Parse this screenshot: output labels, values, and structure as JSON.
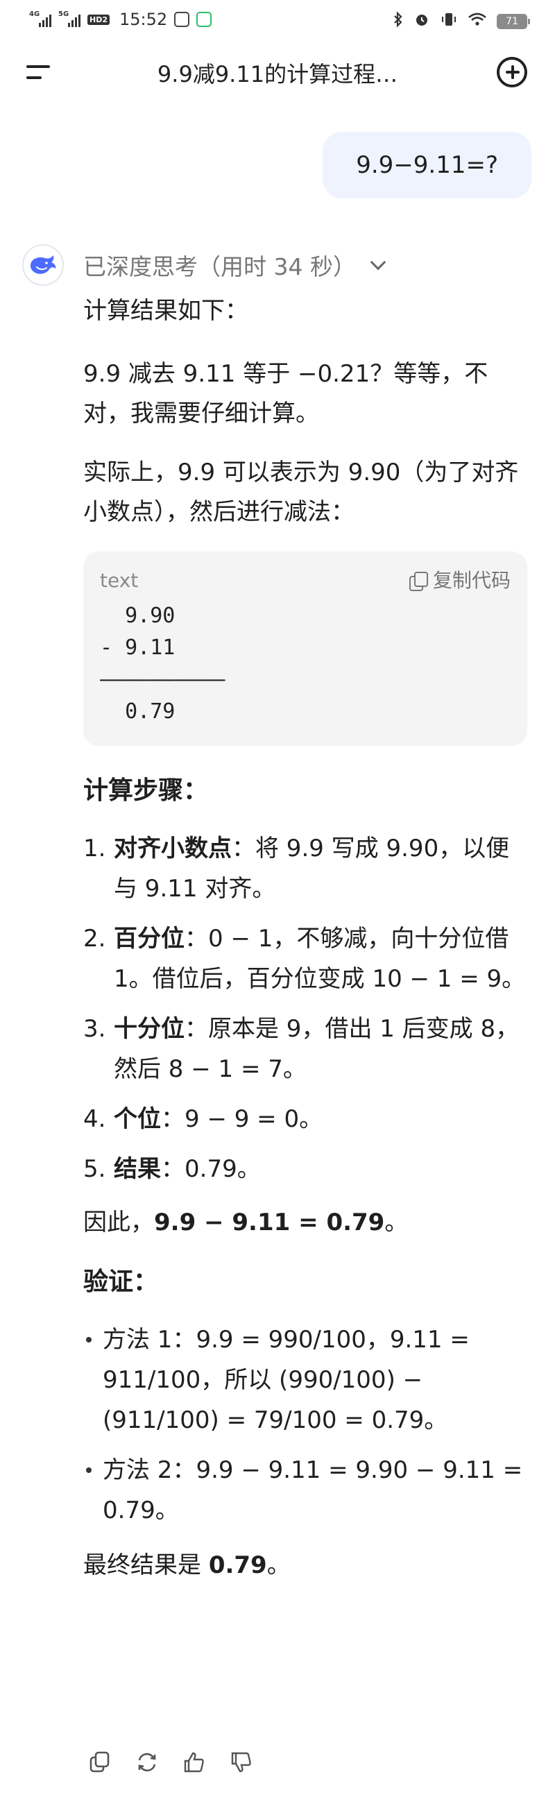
{
  "status_bar": {
    "time": "15:52",
    "network1": "4G",
    "network2": "5G",
    "hd_badge": "HD2",
    "battery": "71"
  },
  "header": {
    "title": "9.9减9.11的计算过程…"
  },
  "user_message": "9.9−9.11=?",
  "assistant": {
    "thinking_label": "已深度思考（用时 34 秒）",
    "intro": "计算结果如下：",
    "para1": "9.9 减去 9.11 等于 −0.21？等等，不对，我需要仔细计算。",
    "para2": "实际上，9.9 可以表示为 9.90（为了对齐小数点），然后进行减法：",
    "code": {
      "lang": "text",
      "copy_label": "复制代码",
      "body": "  9.90\n- 9.11\n——————————\n  0.79"
    },
    "steps_heading": "计算步骤：",
    "steps": [
      {
        "num": "1.",
        "bold": "对齐小数点",
        "text": "：将 9.9 写成 9.90，以便与 9.11 对齐。"
      },
      {
        "num": "2.",
        "bold": "百分位",
        "text": "：0 − 1，不够减，向十分位借 1。借位后，百分位变成 10 − 1 = 9。"
      },
      {
        "num": "3.",
        "bold": "十分位",
        "text": "：原本是 9，借出 1 后变成 8，然后 8 − 1 = 7。"
      },
      {
        "num": "4.",
        "bold": "个位",
        "text": "：9 − 9 = 0。"
      },
      {
        "num": "5.",
        "bold": "结果",
        "text": "：0.79。"
      }
    ],
    "conclusion_prefix": "因此，",
    "conclusion_bold": "9.9 − 9.11 = 0.79",
    "conclusion_suffix": "。",
    "verify_heading": "验证：",
    "verify": [
      "方法 1：9.9 = 990/100，9.11 = 911/100，所以 (990/100) − (911/100) = 79/100 = 0.79。",
      "方法 2：9.9 − 9.11 = 9.90 − 9.11 = 0.79。"
    ],
    "final_prefix": "最终结果是 ",
    "final_bold": "0.79",
    "final_suffix": "。"
  },
  "icons": {
    "menu": "menu-icon",
    "new_chat": "plus-circle-icon",
    "avatar": "whale-logo-icon",
    "copy": "copy-icon",
    "regenerate": "refresh-icon",
    "like": "thumbs-up-icon",
    "dislike": "thumbs-down-icon"
  },
  "colors": {
    "accent": "#4d6bfe",
    "bubble": "#eef3fd",
    "code_bg": "#f4f4f5"
  }
}
